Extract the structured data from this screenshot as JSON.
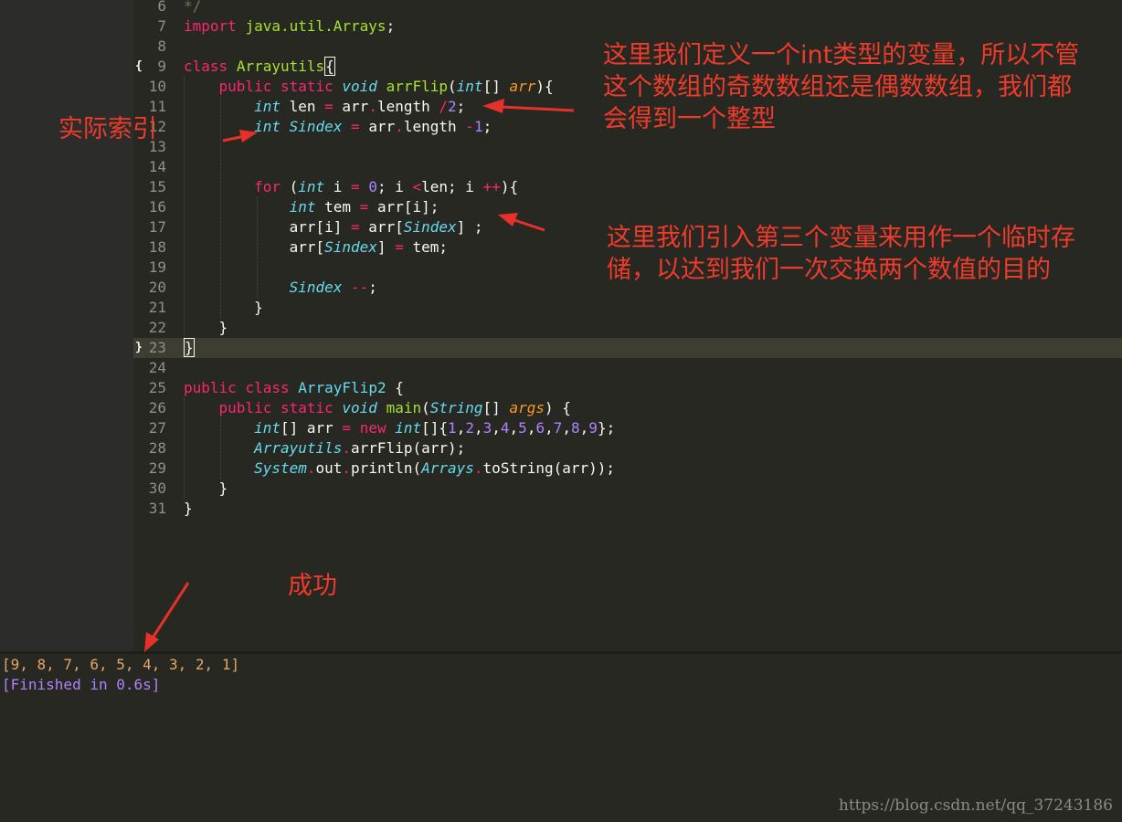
{
  "editor": {
    "lines": [
      {
        "n": "6"
      },
      {
        "n": "7"
      },
      {
        "n": "8"
      },
      {
        "n": "9"
      },
      {
        "n": "10"
      },
      {
        "n": "11"
      },
      {
        "n": "12"
      },
      {
        "n": "13"
      },
      {
        "n": "14"
      },
      {
        "n": "15"
      },
      {
        "n": "16"
      },
      {
        "n": "17"
      },
      {
        "n": "18"
      },
      {
        "n": "19"
      },
      {
        "n": "20"
      },
      {
        "n": "21"
      },
      {
        "n": "22"
      },
      {
        "n": "23"
      },
      {
        "n": "24"
      },
      {
        "n": "25"
      },
      {
        "n": "26"
      },
      {
        "n": "27"
      },
      {
        "n": "28"
      },
      {
        "n": "29"
      },
      {
        "n": "30"
      },
      {
        "n": "31"
      }
    ],
    "fold_open": "{",
    "fold_close": "}"
  },
  "annotations": {
    "int_note_line1": "这里我们定义一个int类型的变量，所以不管",
    "int_note_line2": "这个数组的奇数数组还是偶数数组，我们都",
    "int_note_line3": "会得到一个整型",
    "index_note": "实际索引",
    "swap_note_line1": "这里我们引入第三个变量来用作一个临时存",
    "swap_note_line2": "储，以达到我们一次交换两个数值的目的",
    "success_note": "成功"
  },
  "console": {
    "output": "[9, 8, 7, 6, 5, 4, 3, 2, 1]",
    "finished": "[Finished in 0.6s]"
  },
  "watermark": "https://blog.csdn.net/qq_37243186",
  "colors": {
    "background": "#272822",
    "annotation": "#ee3b2b",
    "output_text": "#e6a565",
    "finished_text": "#ae81ff"
  }
}
